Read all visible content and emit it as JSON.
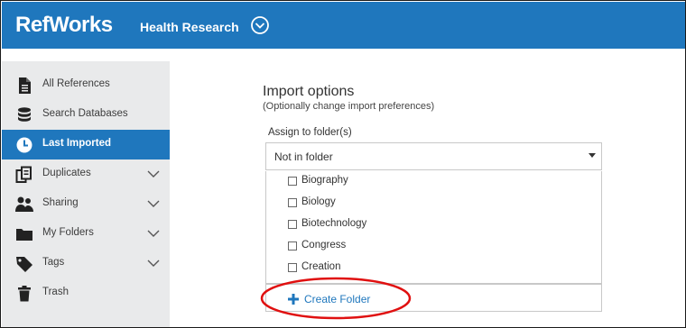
{
  "app": {
    "logo": "RefWorks",
    "project_name": "Health Research"
  },
  "sidebar": {
    "items": [
      {
        "label": "All References",
        "icon": "document-icon",
        "expandable": false,
        "active": false
      },
      {
        "label": "Search Databases",
        "icon": "database-icon",
        "expandable": false,
        "active": false
      },
      {
        "label": "Last Imported",
        "icon": "clock-icon",
        "expandable": false,
        "active": true
      },
      {
        "label": "Duplicates",
        "icon": "duplicates-icon",
        "expandable": true,
        "active": false
      },
      {
        "label": "Sharing",
        "icon": "people-icon",
        "expandable": true,
        "active": false
      },
      {
        "label": "My Folders",
        "icon": "folder-icon",
        "expandable": true,
        "active": false
      },
      {
        "label": "Tags",
        "icon": "tag-icon",
        "expandable": true,
        "active": false
      },
      {
        "label": "Trash",
        "icon": "trash-icon",
        "expandable": false,
        "active": false
      }
    ]
  },
  "import_options": {
    "title": "Import options",
    "subtitle": "(Optionally change import preferences)",
    "assign_label": "Assign to folder(s)",
    "selected_value": "Not in folder",
    "folders": [
      "Biography",
      "Biology",
      "Biotechnology",
      "Congress",
      "Creation"
    ],
    "create_folder_label": "Create Folder"
  },
  "colors": {
    "brand": "#1f77bd",
    "sidebar_bg": "#e9eaeb",
    "highlight": "#e01010"
  }
}
